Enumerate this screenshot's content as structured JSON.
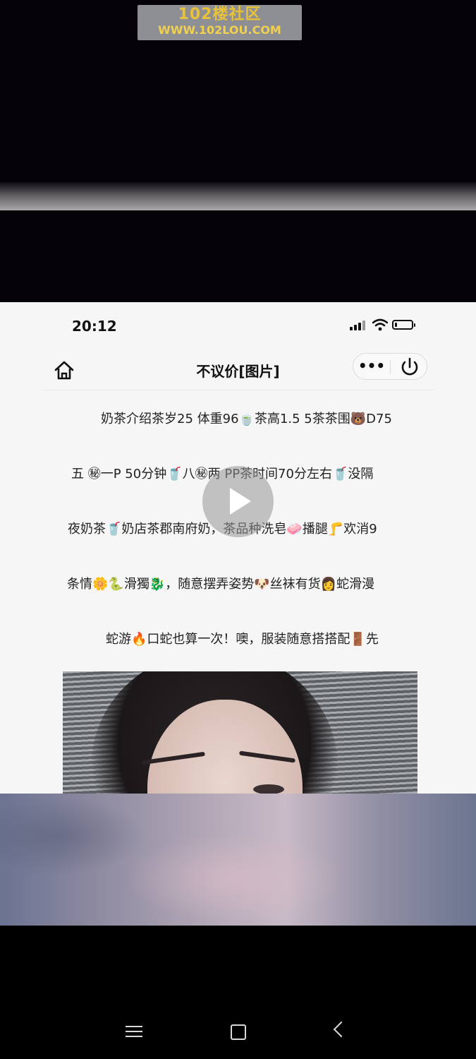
{
  "watermark": {
    "line1": "102楼社区",
    "line2": "WWW.102LOU.COM"
  },
  "status": {
    "time": "20:12",
    "battery_level": 0.15
  },
  "nav": {
    "title": "不议价[图片]",
    "more_label": "•••"
  },
  "article": {
    "lines": [
      "奶茶介绍茶岁25 体重96🍵茶高1.5 5茶茶围🐻D75",
      "五 ㊙一P 50分钟🥤八㊙两 PP茶时间70分左右🥤没隔",
      "夜奶茶🥤奶店茶郡南府奶，茶品种洗皂🧼播腿🦵欢消9",
      "条情🌼🐍滑獨🐉，随意摆弄姿势🐶丝袜有货👩蛇滑漫",
      "蛇游🔥口蛇也算一次！噢，服装随意搭搭配🚪先"
    ]
  },
  "icons": {
    "home": "home-icon",
    "more": "more-icon",
    "power": "power-icon",
    "play": "play-icon",
    "menu": "menu-icon",
    "back": "back-icon"
  },
  "colors": {
    "screen_bg": "#f6f6f7",
    "watermark_text": "#e9c23a",
    "watermark_bg": "#8d8f94"
  }
}
